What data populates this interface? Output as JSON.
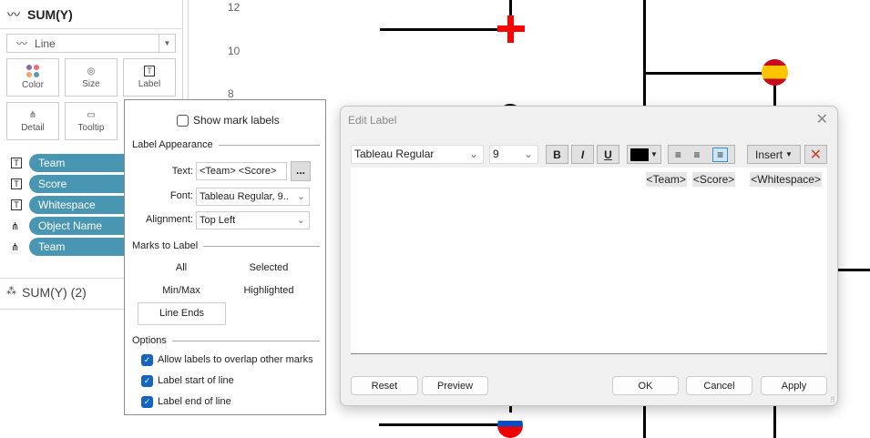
{
  "marks": {
    "title": "SUM(Y)",
    "mark_type": "Line",
    "cards": [
      {
        "label": "Color"
      },
      {
        "label": "Size"
      },
      {
        "label": "Label"
      },
      {
        "label": "Detail"
      },
      {
        "label": "Tooltip"
      }
    ],
    "pills": [
      {
        "label": "Team",
        "icon": "text-icon"
      },
      {
        "label": "Score",
        "icon": "text-icon"
      },
      {
        "label": "Whitespace",
        "icon": "text-icon"
      },
      {
        "label": "Object Name",
        "icon": "detail-icon"
      },
      {
        "label": "Team",
        "icon": "detail-icon"
      }
    ],
    "footer": "SUM(Y) (2)"
  },
  "chart": {
    "y_ticks": [
      "12",
      "10",
      "8"
    ]
  },
  "label_popup": {
    "show_mark_labels": "Show mark labels",
    "show_checked": false,
    "appearance_title": "Label Appearance",
    "text_label": "Text:",
    "text_value": "<Team>  <Score>",
    "ellipsis": "...",
    "font_label": "Font:",
    "font_value": "Tableau Regular, 9..",
    "alignment_label": "Alignment:",
    "alignment_value": "Top Left",
    "marks_title": "Marks to Label",
    "options": [
      "All",
      "Selected",
      "Min/Max",
      "Highlighted",
      "Line Ends"
    ],
    "selected_option": "Line Ends",
    "options_title": "Options",
    "checkboxes": [
      {
        "label": "Allow labels to overlap other marks",
        "checked": true
      },
      {
        "label": "Label start of line",
        "checked": true
      },
      {
        "label": "Label end of line",
        "checked": true
      }
    ]
  },
  "dialog": {
    "title": "Edit Label",
    "font": "Tableau Regular",
    "size": "9",
    "bold": "B",
    "italic": "I",
    "underline": "U",
    "color": "#000000",
    "insert": "Insert",
    "tokens": [
      "<Team>",
      "<Score>",
      "<Whitespace>"
    ],
    "buttons": {
      "reset": "Reset",
      "preview": "Preview",
      "ok": "OK",
      "cancel": "Cancel",
      "apply": "Apply"
    }
  }
}
